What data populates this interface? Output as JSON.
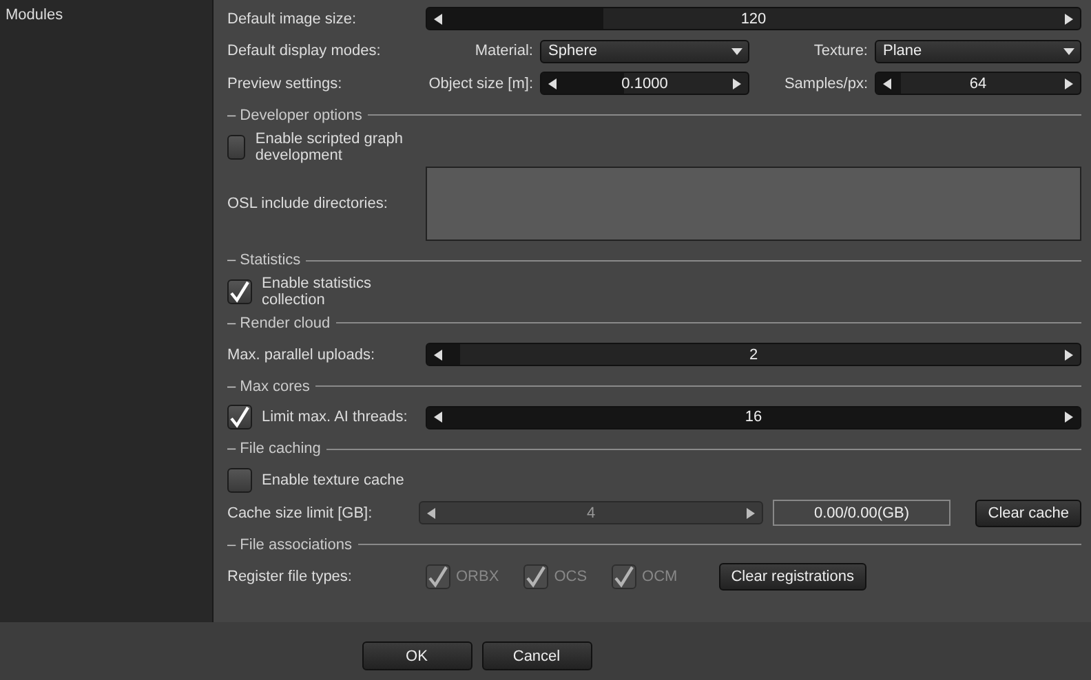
{
  "sidebar": {
    "items": [
      {
        "label": "Modules",
        "selected": false
      }
    ]
  },
  "settings": [
    {
      "kind": "slider",
      "label": "Default image size:",
      "value": "120",
      "level": 0.27
    },
    {
      "kind": "pair",
      "label": "Default display modes:",
      "fields": [
        {
          "kind": "dropdown",
          "label": "Material:",
          "value": "Sphere"
        },
        {
          "kind": "dropdown",
          "label": "Texture:",
          "value": "Plane"
        }
      ]
    },
    {
      "kind": "pair",
      "label": "Preview settings:",
      "fields": [
        {
          "kind": "slider",
          "label": "Object size [m]:",
          "value": "0.1000",
          "level": 0.4
        },
        {
          "kind": "slider",
          "label": "Samples/px:",
          "value": "64",
          "level": 0.12
        }
      ]
    },
    {
      "kind": "section",
      "title": "– Developer options"
    },
    {
      "kind": "checkbox",
      "label": "Enable scripted graph development",
      "checked": false
    },
    {
      "kind": "textarea",
      "label": "OSL include directories:"
    },
    {
      "kind": "section",
      "title": "– Statistics"
    },
    {
      "kind": "checkbox",
      "label": "Enable statistics collection",
      "checked": true
    },
    {
      "kind": "section",
      "title": "– Render cloud"
    },
    {
      "kind": "slider",
      "label": "Max. parallel uploads:",
      "value": "2",
      "level": 0.05
    },
    {
      "kind": "section",
      "title": "– Max cores"
    },
    {
      "kind": "check_slider",
      "label": "Limit max. AI threads:",
      "checked": true,
      "value": "16",
      "level": 1
    },
    {
      "kind": "section",
      "title": "– File caching"
    },
    {
      "kind": "checkbox",
      "label": "Enable texture cache",
      "checked": false
    },
    {
      "kind": "cache",
      "label": "Cache size limit [GB]:",
      "value": "4",
      "disabled": true,
      "usage": "0.00/0.00(GB)",
      "button": "Clear cache"
    },
    {
      "kind": "section",
      "title": "– File associations"
    },
    {
      "kind": "filetypes",
      "label": "Register file types:",
      "types": [
        {
          "label": "ORBX",
          "checked": true,
          "disabled": true
        },
        {
          "label": "OCS",
          "checked": true,
          "disabled": true
        },
        {
          "label": "OCM",
          "checked": true,
          "disabled": true
        }
      ],
      "button": "Clear registrations"
    }
  ],
  "buttons": [
    "OK",
    "Cancel"
  ]
}
